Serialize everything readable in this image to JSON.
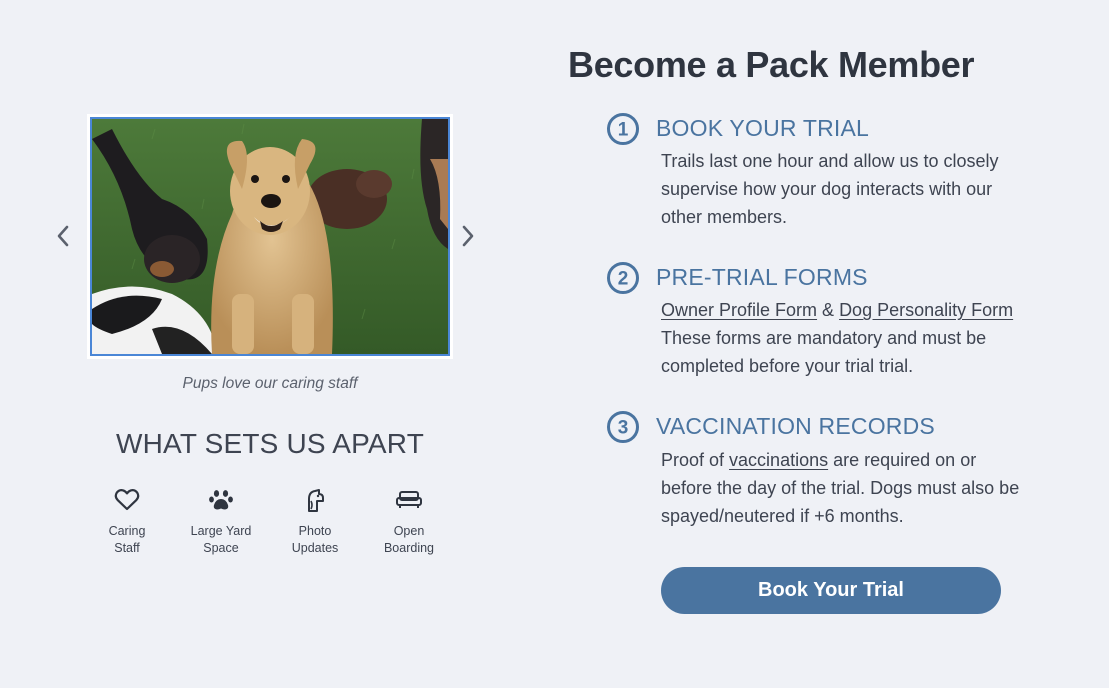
{
  "carousel": {
    "caption": "Pups love our caring staff",
    "prev_icon": "chevron-left-icon",
    "next_icon": "chevron-right-icon"
  },
  "apart": {
    "heading": "WHAT SETS US APART",
    "features": [
      {
        "icon": "heart-icon",
        "label": "Caring\nStaff"
      },
      {
        "icon": "paw-icon",
        "label": "Large Yard\nSpace"
      },
      {
        "icon": "photo-updates-icon",
        "label": "Photo\nUpdates"
      },
      {
        "icon": "couch-icon",
        "label": "Open\nBoarding"
      }
    ]
  },
  "join": {
    "title": "Become a Pack Member",
    "steps": [
      {
        "number": "1",
        "title": "BOOK YOUR TRIAL",
        "body": "Trails last one hour and allow us to closely supervise how your dog interacts with our other members."
      },
      {
        "number": "2",
        "title": "PRE-TRIAL FORMS",
        "link1": "Owner Profile Form",
        "amp": " & ",
        "link2": "Dog Personality Form",
        "body": " These forms are mandatory and must be completed before your trial trial."
      },
      {
        "number": "3",
        "title": "VACCINATION RECORDS",
        "pre": "Proof of ",
        "link": "vaccinations",
        "body": " are required on or before the day of the trial. Dogs must also be spayed/neutered if +6 months."
      }
    ],
    "cta_label": "Book Your Trial"
  },
  "colors": {
    "background": "#eff1f6",
    "accent": "#4a74a0",
    "text": "#3e4451",
    "photo_border": "#4a86d6"
  }
}
